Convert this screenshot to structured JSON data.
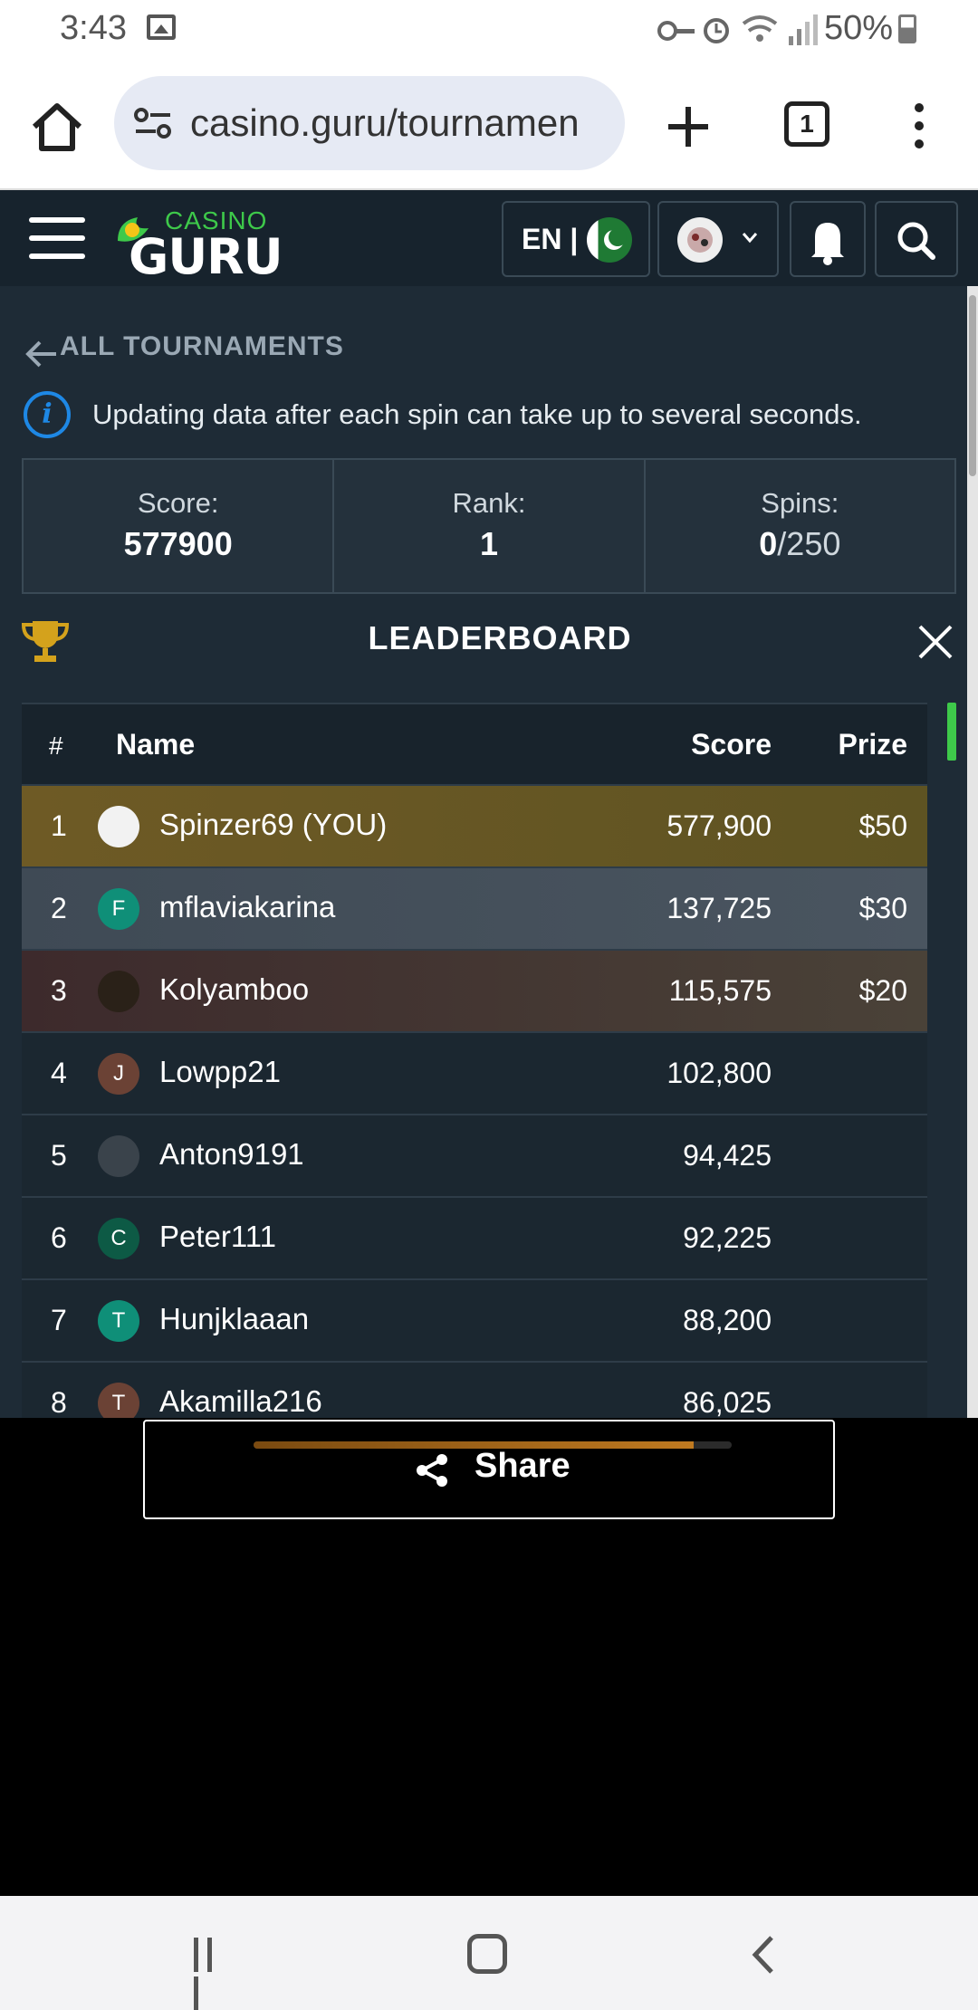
{
  "status_bar": {
    "time": "3:43",
    "battery": "50%"
  },
  "browser": {
    "url": "casino.guru/tournamen",
    "tab_count": "1"
  },
  "site": {
    "logo_top": "CASINO",
    "logo_bottom": "GURU",
    "lang": "EN |"
  },
  "page": {
    "back_label": "ALL TOURNAMENTS",
    "info_text": "Updating data after each spin can take up to several seconds.",
    "stats": {
      "score_label": "Score:",
      "score_value": "577900",
      "rank_label": "Rank:",
      "rank_value": "1",
      "spins_label": "Spins:",
      "spins_used": "0",
      "spins_total": "/250"
    },
    "leaderboard_title": "LEADERBOARD",
    "columns": {
      "rank": "#",
      "name": "Name",
      "score": "Score",
      "prize": "Prize"
    },
    "rows": [
      {
        "rank": "1",
        "name": "Spinzer69 (YOU)",
        "score": "577,900",
        "prize": "$50",
        "initial": "",
        "avatar_color": "#f2f2f2"
      },
      {
        "rank": "2",
        "name": "mflaviakarina",
        "score": "137,725",
        "prize": "$30",
        "initial": "F",
        "avatar_color": "#0f8f78"
      },
      {
        "rank": "3",
        "name": "Kolyamboo",
        "score": "115,575",
        "prize": "$20",
        "initial": "",
        "avatar_color": "#2a2118"
      },
      {
        "rank": "4",
        "name": "Lowpp21",
        "score": "102,800",
        "prize": "",
        "initial": "J",
        "avatar_color": "#6b4235"
      },
      {
        "rank": "5",
        "name": "Anton9191",
        "score": "94,425",
        "prize": "",
        "initial": "",
        "avatar_color": "#3a434b"
      },
      {
        "rank": "6",
        "name": "Peter111",
        "score": "92,225",
        "prize": "",
        "initial": "C",
        "avatar_color": "#0d5a45"
      },
      {
        "rank": "7",
        "name": "Hunjklaaan",
        "score": "88,200",
        "prize": "",
        "initial": "T",
        "avatar_color": "#0f8f78"
      },
      {
        "rank": "8",
        "name": "Akamilla216",
        "score": "86,025",
        "prize": "",
        "initial": "T",
        "avatar_color": "#6b4235"
      }
    ],
    "row_backgrounds": [
      "linear-gradient(to right,#6e5a25,#5e5322)",
      "linear-gradient(to right,#3f4a55,#4a5560)",
      "linear-gradient(to right,#3d2a2c,#4a4238)"
    ]
  },
  "share": {
    "label": "Share",
    "progress": 0.92
  }
}
